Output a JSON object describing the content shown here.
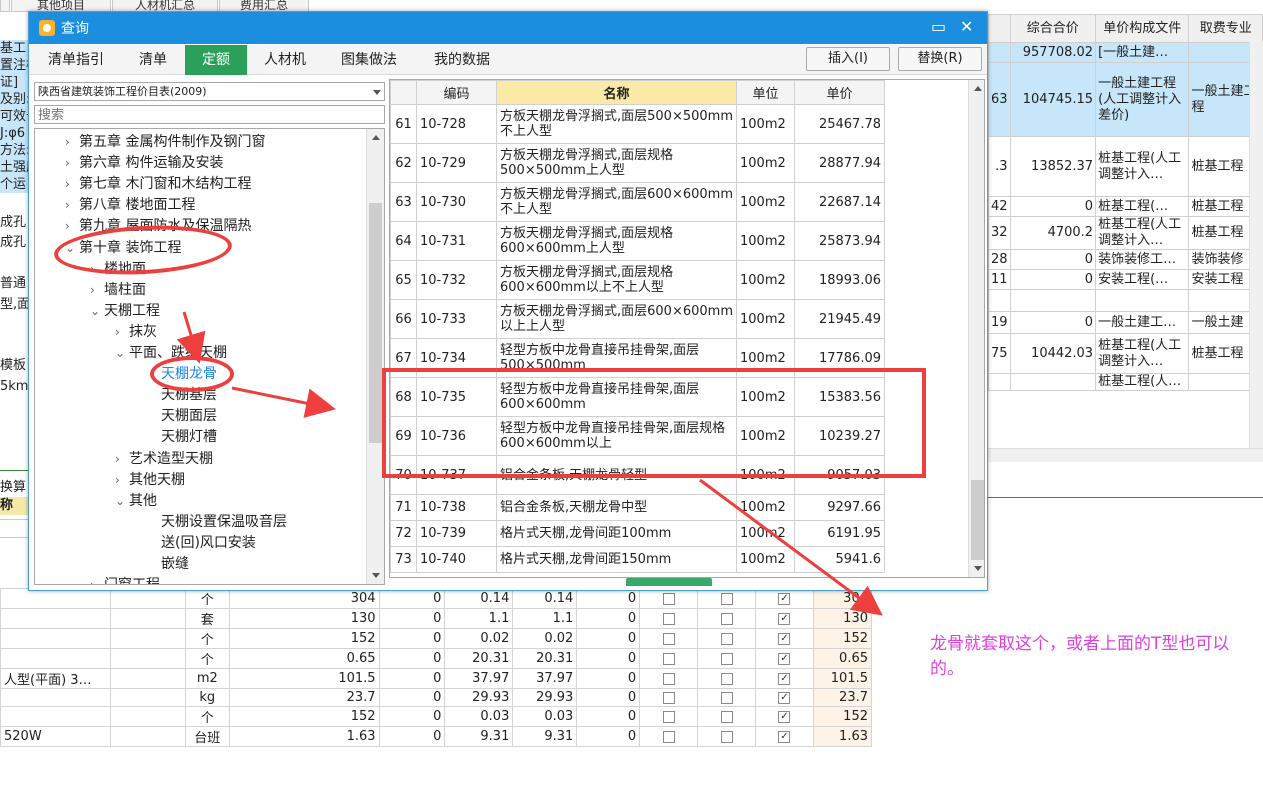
{
  "bg_tabs": [
    "其他项目",
    "人材机汇总",
    "费用汇总"
  ],
  "bg_header": [
    "综合合价",
    "单价构成文件",
    "取费专业"
  ],
  "bg_rows": [
    {
      "pre": "",
      "total": "957708.02",
      "file": "[一般土建…",
      "fee": ""
    },
    {
      "pre": "63",
      "total": "104745.15",
      "file": "一般土建工程(人工调整计入差价)",
      "fee": "一般土建工程"
    },
    {
      "pre": ".3",
      "total": "13852.37",
      "file": "桩基工程(人工调整计入…",
      "fee": "桩基工程"
    },
    {
      "pre": "42",
      "total": "0",
      "file": "桩基工程(…",
      "fee": "桩基工程"
    },
    {
      "pre": "32",
      "total": "4700.2",
      "file": "桩基工程(人工调整计入…",
      "fee": "桩基工程"
    },
    {
      "pre": "28",
      "total": "0",
      "file": "装饰装修工…",
      "fee": "装饰装修"
    },
    {
      "pre": "11",
      "total": "0",
      "file": "安装工程(…",
      "fee": "安装工程"
    },
    {
      "pre": "",
      "total": "",
      "file": "",
      "fee": ""
    },
    {
      "pre": "19",
      "total": "0",
      "file": "一般土建工…",
      "fee": "一般土建"
    },
    {
      "pre": "75",
      "total": "10442.03",
      "file": "桩基工程(人工调整计入…",
      "fee": "桩基工程"
    },
    {
      "pre": "",
      "total": "",
      "file": "桩基工程(人…",
      "fee": ""
    }
  ],
  "left_strip": [
    "基工",
    "置注桩",
    "证]",
    "及别:",
    "可效长",
    "J:φ6",
    "方法:",
    "土强度",
    "个运",
    "",
    "成孔",
    "成孔",
    "",
    "普通",
    "型,面",
    "",
    "",
    "模板",
    "5km"
  ],
  "left_strip_bottom": [
    "换算",
    "称"
  ],
  "bottom_rows": [
    {
      "name": "",
      "unit": "个",
      "a": "304",
      "b": "0",
      "c": "0.14",
      "d": "0.14",
      "e": "0",
      "chk": "✓",
      "last": "304"
    },
    {
      "name": "",
      "unit": "套",
      "a": "130",
      "b": "0",
      "c": "1.1",
      "d": "1.1",
      "e": "0",
      "chk": "✓",
      "last": "130"
    },
    {
      "name": "",
      "unit": "个",
      "a": "152",
      "b": "0",
      "c": "0.02",
      "d": "0.02",
      "e": "0",
      "chk": "✓",
      "last": "152"
    },
    {
      "name": "",
      "unit": "个",
      "a": "0.65",
      "b": "0",
      "c": "20.31",
      "d": "20.31",
      "e": "0",
      "chk": "✓",
      "last": "0.65"
    },
    {
      "name": "人型(平面) 3…",
      "unit": "m2",
      "a": "101.5",
      "b": "0",
      "c": "37.97",
      "d": "37.97",
      "e": "0",
      "chk": "✓",
      "last": "101.5"
    },
    {
      "name": "",
      "unit": "kg",
      "a": "23.7",
      "b": "0",
      "c": "29.93",
      "d": "29.93",
      "e": "0",
      "chk": "✓",
      "last": "23.7"
    },
    {
      "name": "",
      "unit": "个",
      "a": "152",
      "b": "0",
      "c": "0.03",
      "d": "0.03",
      "e": "0",
      "chk": "✓",
      "last": "152"
    },
    {
      "name": "520W",
      "unit": "台班",
      "a": "1.63",
      "b": "0",
      "c": "9.31",
      "d": "9.31",
      "e": "0",
      "chk": "✓",
      "last": "1.63"
    }
  ],
  "dialog": {
    "title": "查询",
    "tabs": [
      "清单指引",
      "清单",
      "定额",
      "人材机",
      "图集做法",
      "我的数据"
    ],
    "active_tab": "定额",
    "insert_btn": "插入(I)",
    "replace_btn": "替换(R)",
    "combo_value": "陕西省建筑装饰工程价目表(2009)",
    "search_placeholder": "搜索"
  },
  "tree": [
    {
      "label": "第五章 金属构件制作及钢门窗",
      "level": 1,
      "tog": "›"
    },
    {
      "label": "第六章 构件运输及安装",
      "level": 1,
      "tog": "›"
    },
    {
      "label": "第七章 木门窗和木结构工程",
      "level": 1,
      "tog": "›"
    },
    {
      "label": "第八章 楼地面工程",
      "level": 1,
      "tog": "›"
    },
    {
      "label": "第九章 屋面防水及保温隔热",
      "level": 1,
      "tog": "›"
    },
    {
      "label": "第十章 装饰工程",
      "level": 1,
      "tog": "⌄"
    },
    {
      "label": "楼地面",
      "level": 2,
      "tog": "›"
    },
    {
      "label": "墙柱面",
      "level": 2,
      "tog": "›"
    },
    {
      "label": "天棚工程",
      "level": 2,
      "tog": "⌄"
    },
    {
      "label": "抹灰",
      "level": 3,
      "tog": "›"
    },
    {
      "label": "平面、跌级天棚",
      "level": 3,
      "tog": "⌄"
    },
    {
      "label": "天棚龙骨",
      "level": 4,
      "tog": "",
      "selected": true
    },
    {
      "label": "天棚基层",
      "level": 4,
      "tog": ""
    },
    {
      "label": "天棚面层",
      "level": 4,
      "tog": ""
    },
    {
      "label": "天棚灯槽",
      "level": 4,
      "tog": ""
    },
    {
      "label": "艺术造型天棚",
      "level": 3,
      "tog": "›"
    },
    {
      "label": "其他天棚",
      "level": 3,
      "tog": "›"
    },
    {
      "label": "其他",
      "level": 3,
      "tog": "⌄"
    },
    {
      "label": "天棚设置保温吸音层",
      "level": 4,
      "tog": ""
    },
    {
      "label": "送(回)风口安装",
      "level": 4,
      "tog": ""
    },
    {
      "label": "嵌缝",
      "level": 4,
      "tog": ""
    },
    {
      "label": "门窗工程",
      "level": 2,
      "tog": "›"
    }
  ],
  "table": {
    "headers": [
      "",
      "编码",
      "名称",
      "单位",
      "单价"
    ],
    "rows": [
      {
        "idx": "61",
        "code": "10-728",
        "name": "方板天棚龙骨浮搁式,面层500×500mm不上人型",
        "unit": "100m2",
        "price": "25467.78"
      },
      {
        "idx": "62",
        "code": "10-729",
        "name": "方板天棚龙骨浮搁式,面层规格500×500mm上人型",
        "unit": "100m2",
        "price": "28877.94"
      },
      {
        "idx": "63",
        "code": "10-730",
        "name": "方板天棚龙骨浮搁式,面层600×600mm不上人型",
        "unit": "100m2",
        "price": "22687.14"
      },
      {
        "idx": "64",
        "code": "10-731",
        "name": "方板天棚龙骨浮搁式,面层规格600×600mm上人型",
        "unit": "100m2",
        "price": "25873.94"
      },
      {
        "idx": "65",
        "code": "10-732",
        "name": "方板天棚龙骨浮搁式,面层规格600×600mm以上不上人型",
        "unit": "100m2",
        "price": "18993.06"
      },
      {
        "idx": "66",
        "code": "10-733",
        "name": "方板天棚龙骨浮搁式,面层600×600mm以上上人型",
        "unit": "100m2",
        "price": "21945.49"
      },
      {
        "idx": "67",
        "code": "10-734",
        "name": "轻型方板中龙骨直接吊挂骨架,面层500×500mm",
        "unit": "100m2",
        "price": "17786.09"
      },
      {
        "idx": "68",
        "code": "10-735",
        "name": "轻型方板中龙骨直接吊挂骨架,面层600×600mm",
        "unit": "100m2",
        "price": "15383.56"
      },
      {
        "idx": "69",
        "code": "10-736",
        "name": "轻型方板中龙骨直接吊挂骨架,面层规格600×600mm以上",
        "unit": "100m2",
        "price": "10239.27"
      },
      {
        "idx": "70",
        "code": "10-737",
        "name": "铝合金条板,天棚龙骨轻型",
        "unit": "100m2",
        "price": "9057.03"
      },
      {
        "idx": "71",
        "code": "10-738",
        "name": "铝合金条板,天棚龙骨中型",
        "unit": "100m2",
        "price": "9297.66"
      },
      {
        "idx": "72",
        "code": "10-739",
        "name": "格片式天棚,龙骨间距100mm",
        "unit": "100m2",
        "price": "6191.95"
      },
      {
        "idx": "73",
        "code": "10-740",
        "name": "格片式天棚,龙骨间距150mm",
        "unit": "100m2",
        "price": "5941.6"
      }
    ]
  },
  "annotation_note": "龙骨就套取这个，或者上面的T型也可以的。",
  "colors": {
    "title_bar": "#1c8ee0",
    "active_tab": "#2aa05a",
    "annotation": "#ee3f3f",
    "note": "#e040e0",
    "name_header": "#fbe9a8"
  }
}
